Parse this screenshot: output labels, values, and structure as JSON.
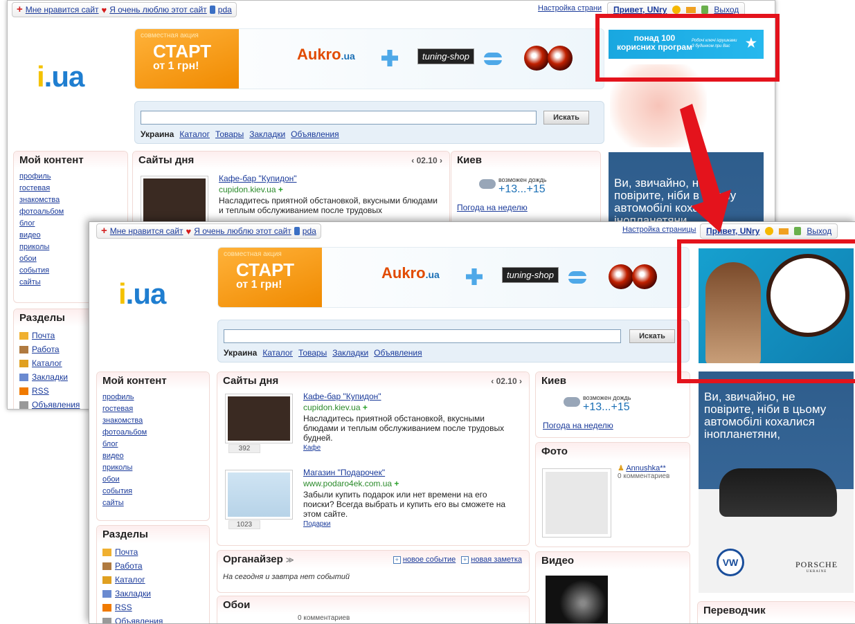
{
  "top": {
    "like_site": "Мне нравится сайт",
    "love_site": "Я очень люблю этот сайт",
    "pda": "pda",
    "settings": "Настройка страницы",
    "settings_short": "Настройка страни",
    "greeting": "Привет, UNry",
    "logout": "Выход"
  },
  "logo": {
    "i": "i",
    "ua": ".ua"
  },
  "banner": {
    "caption": "совместная акция",
    "start": "СТАРТ",
    "from": "от 1 грн!",
    "aukro": "Aukro",
    "aukro_ua": ".ua",
    "tshop": "tuning-shop"
  },
  "search": {
    "button": "Искать",
    "tabs": [
      "Украина",
      "Каталог",
      "Товары",
      "Закладки",
      "Объявления"
    ]
  },
  "my_content": {
    "title": "Мой контент",
    "items": [
      "профиль",
      "гостевая",
      "знакомства",
      "фотоальбом",
      "блог",
      "видео",
      "приколы",
      "обои",
      "события",
      "сайты"
    ]
  },
  "sections": {
    "title": "Разделы",
    "items": [
      "Почта",
      "Работа",
      "Каталог",
      "Закладки",
      "RSS",
      "Объявления"
    ],
    "icon_colors": [
      "#f0b030",
      "#b07a40",
      "#e0a020",
      "#6a8ad0",
      "#f07a00",
      "#999999"
    ],
    "last_cut": "Объявления",
    "last_cut2": "Объявления"
  },
  "sites": {
    "title": "Сайты дня",
    "date": "‹ 02.10 ›",
    "items": [
      {
        "name": "Кафе-бар \"Купидон\"",
        "url": "cupidon.kiev.ua",
        "desc": "Насладитесь приятной обстановкой, вкусными блюдами и теплым обслуживанием после трудовых будней.",
        "desc_cut": "Насладитесь приятной обстановкой, вкусными блюдами и теплым обслуживанием после трудовых",
        "cat": "Кафе",
        "count": "392"
      },
      {
        "name": "Магазин \"Подарочек\"",
        "url": "www.podaro4ek.com.ua",
        "desc": "Забыли купить подарок или нет времени на его поиски? Всегда выбрать и купить его вы сможете на этом сайте.",
        "cat": "Подарки",
        "count": "1023"
      }
    ]
  },
  "kiev": {
    "title": "Киев",
    "forecast": "возможен дождь",
    "temp": "+13...+15",
    "week": "Погода на неделю"
  },
  "photo": {
    "title": "Фото",
    "user": "Annushka**",
    "comments": "0 комментариев"
  },
  "organizer": {
    "title": "Органайзер",
    "new_event": "новое событие",
    "new_note": "новая заметка",
    "empty": "На сегодня и завтра нет событий"
  },
  "wallpapers": {
    "title": "Обои",
    "comments": "0 комментариев"
  },
  "video": {
    "title": "Видео"
  },
  "translator": {
    "title": "Переводчик"
  },
  "ads": {
    "blue_big": "понад 100",
    "blue_big2": "корисних програм",
    "blue_small": "Робочі ключі ігрушками",
    "blue_small2": "З будинком при Вас",
    "car_text": "Ви, звичайно, не повірите, ніби в цьому автомобілі кохалися інопланетяни,",
    "porsche": "PORSCHE",
    "porsche_sub": "UKRAINE"
  },
  "colors": {
    "highlight": "#e4131c",
    "link": "#1a3a9a",
    "accent_orange": "#f08a00",
    "accent_blue": "#1f7ed0"
  }
}
